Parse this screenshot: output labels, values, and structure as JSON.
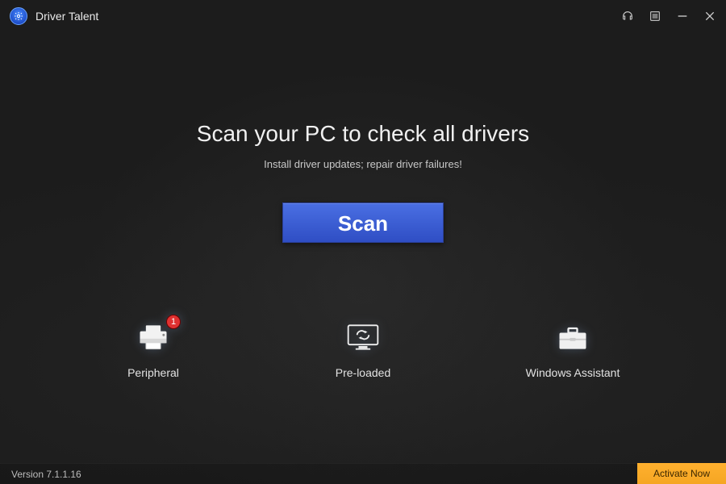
{
  "header": {
    "app_title": "Driver Talent"
  },
  "main": {
    "headline": "Scan your PC to check all drivers",
    "subtext": "Install driver updates; repair driver failures!",
    "scan_label": "Scan"
  },
  "features": {
    "peripheral": {
      "label": "Peripheral",
      "badge": "1"
    },
    "preloaded": {
      "label": "Pre-loaded"
    },
    "assistant": {
      "label": "Windows Assistant"
    }
  },
  "footer": {
    "version": "Version 7.1.1.16",
    "activate_label": "Activate Now"
  }
}
